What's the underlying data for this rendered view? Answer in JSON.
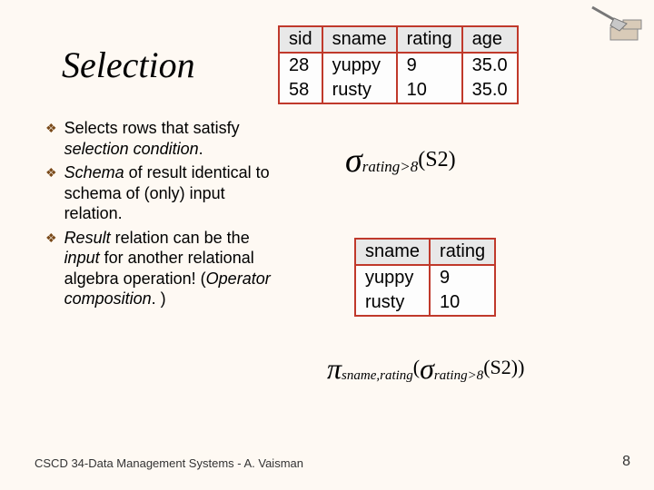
{
  "title": "Selection",
  "bullets": [
    {
      "pre": "Selects rows that satisfy ",
      "em": "selection condition",
      "post": "."
    },
    {
      "pre": "",
      "em": "Schema",
      "post": " of result identical to schema of (only) input relation."
    },
    {
      "pre": "",
      "em": "Result",
      "post": " relation can be the ",
      "em2": "input",
      "post2": " for another relational algebra operation! (",
      "em3": "Operator composition",
      "post3": ". )"
    }
  ],
  "table1": {
    "headers": [
      "sid",
      "sname",
      "rating",
      "age"
    ],
    "rows": [
      [
        "28",
        "yuppy",
        "9",
        "35.0"
      ],
      [
        "58",
        "rusty",
        "10",
        "35.0"
      ]
    ]
  },
  "table2": {
    "headers": [
      "sname",
      "rating"
    ],
    "rows": [
      [
        "yuppy",
        "9"
      ],
      [
        "rusty",
        "10"
      ]
    ]
  },
  "formula1": {
    "sigma": "σ",
    "sub": "rating>8",
    "arg": "(S2)"
  },
  "formula2": {
    "pi": "π",
    "sub1": "sname,rating",
    "sigma": "σ",
    "sub2": "rating>8",
    "arg": "(S2))",
    "open": "("
  },
  "footer": "CSCD 34-Data Management Systems - A. Vaisman",
  "page": "8",
  "decor_colors": {
    "brick": "#d9cbb8",
    "trowel": "#b0b0b0"
  }
}
